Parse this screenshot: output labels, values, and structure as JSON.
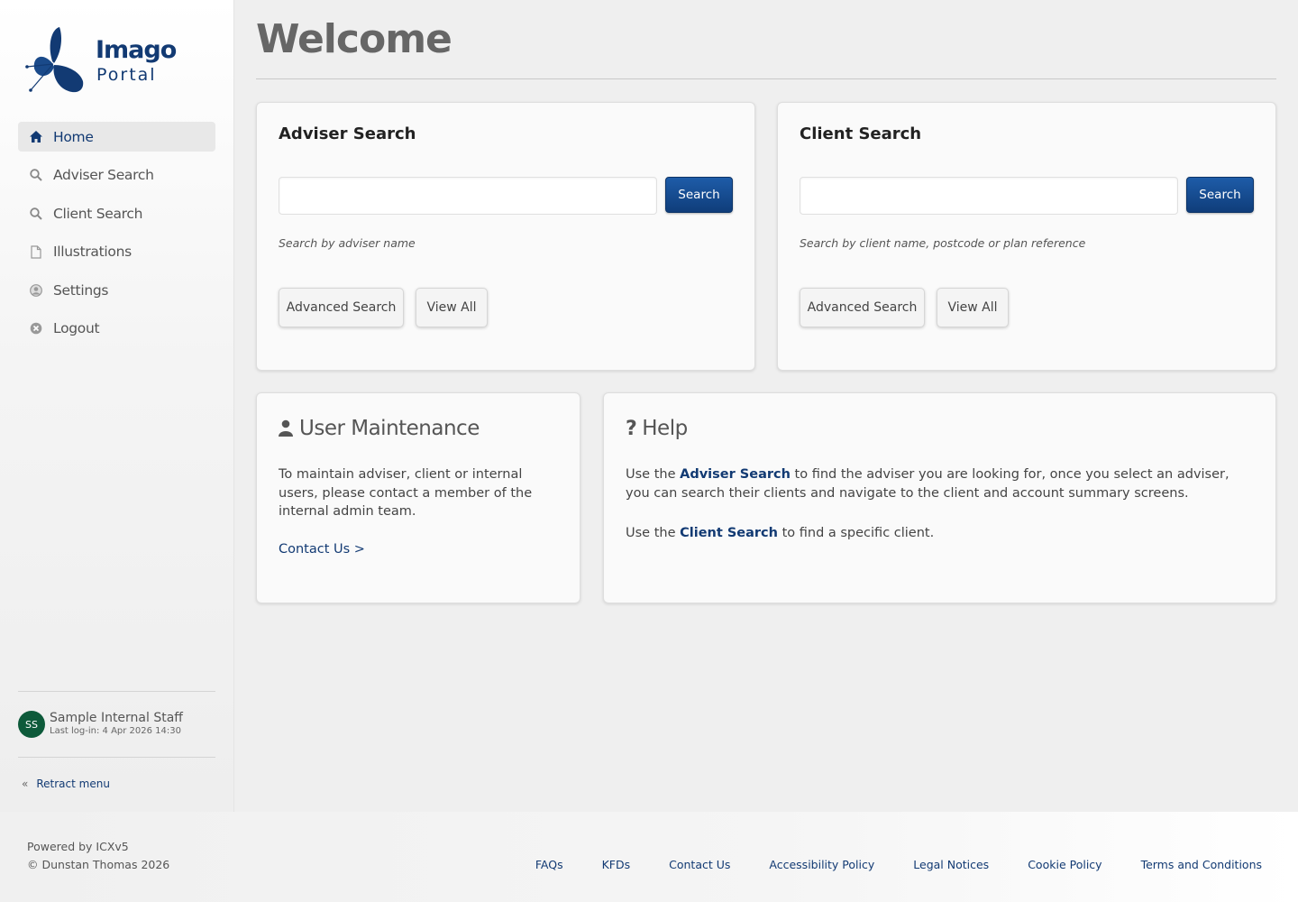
{
  "logo": {
    "word1": "Imago",
    "word2": "Portal"
  },
  "nav": {
    "items": [
      {
        "label": "Home",
        "icon": "home-icon",
        "active": true
      },
      {
        "label": "Adviser Search",
        "icon": "search-icon"
      },
      {
        "label": "Client Search",
        "icon": "search-icon"
      },
      {
        "label": "Illustrations",
        "icon": "document-icon"
      },
      {
        "label": "Settings",
        "icon": "user-circle-icon"
      },
      {
        "label": "Logout",
        "icon": "close-circle-icon"
      }
    ]
  },
  "user": {
    "initials": "SS",
    "name": "Sample Internal Staff",
    "last_login": "Last log-in: 4 Apr 2026 14:30"
  },
  "retract_label": "Retract menu",
  "page_title": "Welcome",
  "adviser_search": {
    "title": "Adviser Search",
    "input_value": "",
    "search_label": "Search",
    "hint": "Search by adviser name",
    "advanced_label": "Advanced Search",
    "view_all_label": "View All"
  },
  "client_search": {
    "title": "Client Search",
    "input_value": "",
    "search_label": "Search",
    "hint": "Search by client name, postcode or plan reference",
    "advanced_label": "Advanced Search",
    "view_all_label": "View All"
  },
  "user_maintenance": {
    "title": "User Maintenance",
    "body": "To maintain adviser, client or internal users, please contact a member of the internal admin team.",
    "contact_link": "Contact Us >"
  },
  "help": {
    "title": "Help",
    "p1_pre": "Use the ",
    "p1_link": "Adviser Search",
    "p1_post": " to find the adviser you are looking for, once you select an adviser, you can search their clients and navigate to the client and account summary screens.",
    "p2_pre": "Use the ",
    "p2_link": "Client Search",
    "p2_post": " to find a specific client."
  },
  "footer": {
    "powered": "Powered by ICXv5",
    "copyright": "© Dunstan Thomas 2026",
    "links": [
      "FAQs",
      "KFDs",
      "Contact Us",
      "Accessibility Policy",
      "Legal Notices",
      "Cookie Policy",
      "Terms and Conditions"
    ]
  },
  "colors": {
    "brand": "#123a73",
    "primary_button": "#0f3d7a",
    "avatar": "#0d5a3a"
  }
}
